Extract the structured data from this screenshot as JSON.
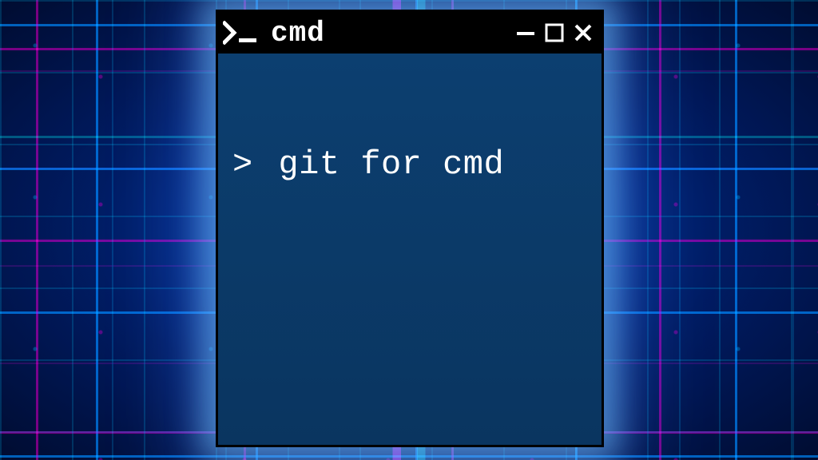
{
  "window": {
    "title": "cmd",
    "icon": "terminal-prompt-icon",
    "controls": {
      "minimize": "−",
      "maximize": "□",
      "close": "×"
    }
  },
  "terminal": {
    "prompt": ">",
    "command": "git for cmd"
  },
  "colors": {
    "titlebar_bg": "#000000",
    "titlebar_fg": "#ffffff",
    "body_bg": "#0a3a66",
    "body_fg": "#ffffff"
  }
}
